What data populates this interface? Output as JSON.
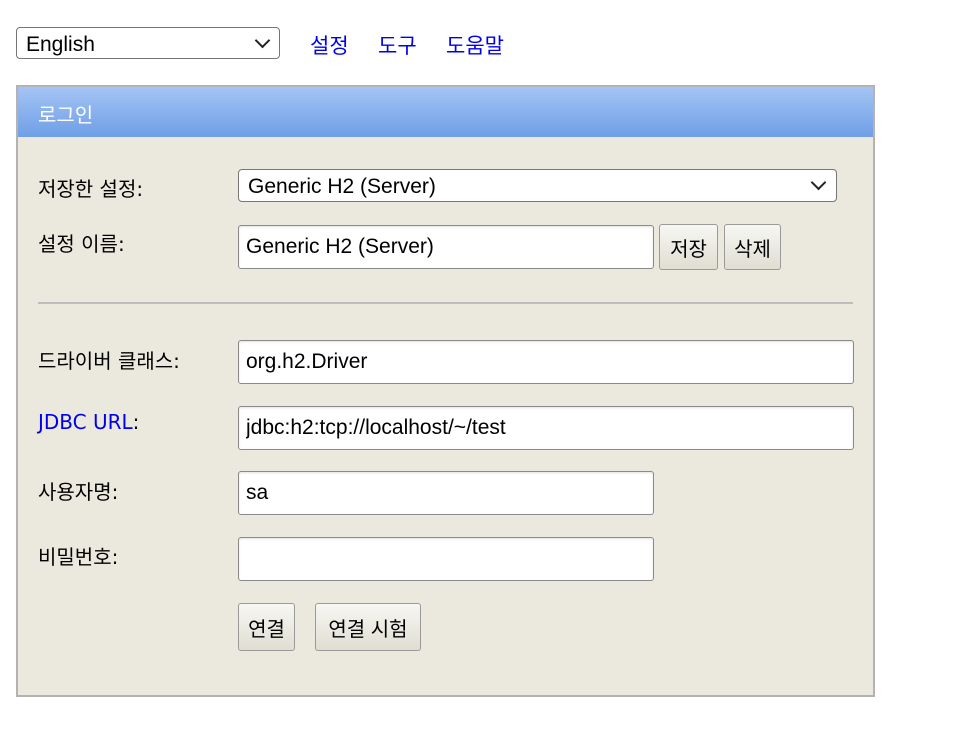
{
  "top": {
    "language": "English",
    "links": {
      "settings": "설정",
      "tools": "도구",
      "help": "도움말"
    }
  },
  "login": {
    "title": "로그인",
    "saved_settings_label": "저장한 설정:",
    "saved_settings_value": "Generic H2 (Server)",
    "setting_name_label": "설정 이름:",
    "setting_name_value": "Generic H2 (Server)",
    "save_button": "저장",
    "delete_button": "삭제",
    "driver_class_label": "드라이버 클래스:",
    "driver_class_value": "org.h2.Driver",
    "jdbc_url_label": "JDBC URL",
    "jdbc_url_colon": ":",
    "jdbc_url_value": "jdbc:h2:tcp://localhost/~/test",
    "username_label": "사용자명:",
    "username_value": "sa",
    "password_label": "비밀번호:",
    "password_value": "",
    "connect_button": "연결",
    "test_connection_button": "연결 시험"
  },
  "colors": {
    "header_gradient_top": "#a4c4f4",
    "header_gradient_bottom": "#6f9fe6",
    "panel_background": "#ebe9dd",
    "link": "#0000ee"
  }
}
